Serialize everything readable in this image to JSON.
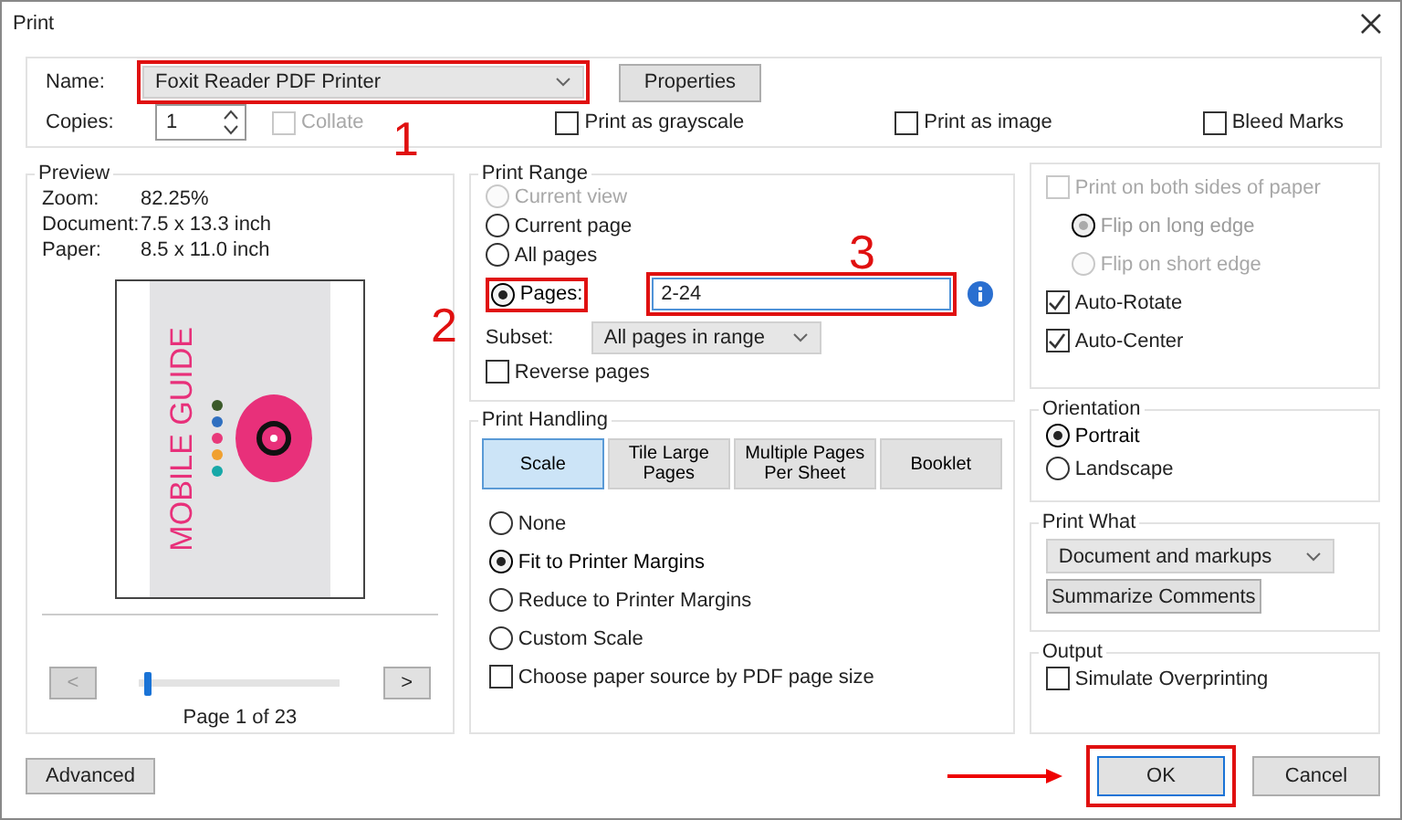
{
  "window": {
    "title": "Print"
  },
  "printer": {
    "name_label": "Name:",
    "name": "Foxit Reader PDF Printer",
    "properties": "Properties",
    "copies_label": "Copies:",
    "copies": "1",
    "collate": {
      "label": "Collate",
      "checked": false,
      "disabled": true
    }
  },
  "options": [
    {
      "label": "Print as grayscale",
      "checked": false
    },
    {
      "label": "Print as image",
      "checked": false
    },
    {
      "label": "Bleed Marks",
      "checked": false
    }
  ],
  "preview": {
    "title": "Preview",
    "info": [
      {
        "label": "Zoom:",
        "value": "82.25%"
      },
      {
        "label": "Document:",
        "value": "7.5 x 13.3 inch"
      },
      {
        "label": "Paper:",
        "value": "8.5 x 11.0 inch"
      }
    ],
    "page_title": "MOBILE GUIDE",
    "dots": [
      {
        "color": "#3b5a2a"
      },
      {
        "color": "#2f6fc0"
      },
      {
        "color": "#e8397a"
      },
      {
        "color": "#f0a030"
      },
      {
        "color": "#17a8a8"
      }
    ],
    "prev": "<",
    "next": ">",
    "level": 0.02,
    "page_label": "Page 1 of 23"
  },
  "print_range": {
    "title": "Print Range",
    "options": [
      {
        "label": "Current view",
        "selected": false,
        "disabled": true
      },
      {
        "label": "Current page",
        "selected": false,
        "disabled": false
      },
      {
        "label": "All pages",
        "selected": false,
        "disabled": false
      },
      {
        "label": "Pages:",
        "selected": true,
        "disabled": false
      }
    ],
    "pages_value": "2-24",
    "subset_label": "Subset:",
    "subset": "All pages in range",
    "reverse": {
      "label": "Reverse pages",
      "checked": false
    }
  },
  "print_handling": {
    "title": "Print Handling",
    "tabs": [
      {
        "label": "Scale",
        "selected": true
      },
      {
        "label": "Tile Large Pages",
        "selected": false
      },
      {
        "label": "Multiple Pages Per Sheet",
        "selected": false
      },
      {
        "label": "Booklet",
        "selected": false
      }
    ],
    "scale_options": [
      {
        "label": "None",
        "selected": false
      },
      {
        "label": "Fit to Printer Margins",
        "selected": true
      },
      {
        "label": "Reduce to Printer Margins",
        "selected": false
      },
      {
        "label": "Custom Scale",
        "selected": false
      }
    ],
    "paper_source": {
      "label": "Choose paper source by PDF page size",
      "checked": false
    }
  },
  "duplex": {
    "both_sides": {
      "label": "Print on both sides of paper",
      "checked": false,
      "disabled": true
    },
    "flip": [
      {
        "label": "Flip on long edge",
        "selected": true,
        "disabled": true
      },
      {
        "label": "Flip on short edge",
        "selected": false,
        "disabled": true
      }
    ],
    "auto": [
      {
        "label": "Auto-Rotate",
        "checked": true
      },
      {
        "label": "Auto-Center",
        "checked": true
      }
    ]
  },
  "orientation": {
    "title": "Orientation",
    "options": [
      {
        "label": "Portrait",
        "selected": true
      },
      {
        "label": "Landscape",
        "selected": false
      }
    ]
  },
  "print_what": {
    "title": "Print What",
    "value": "Document and markups",
    "summarize": "Summarize Comments"
  },
  "output": {
    "title": "Output",
    "simulate": {
      "label": "Simulate Overprinting",
      "checked": false
    }
  },
  "buttons": {
    "advanced": "Advanced",
    "ok": "OK",
    "cancel": "Cancel"
  },
  "annotations": [
    {
      "label": "1"
    },
    {
      "label": "2"
    },
    {
      "label": "3"
    }
  ]
}
